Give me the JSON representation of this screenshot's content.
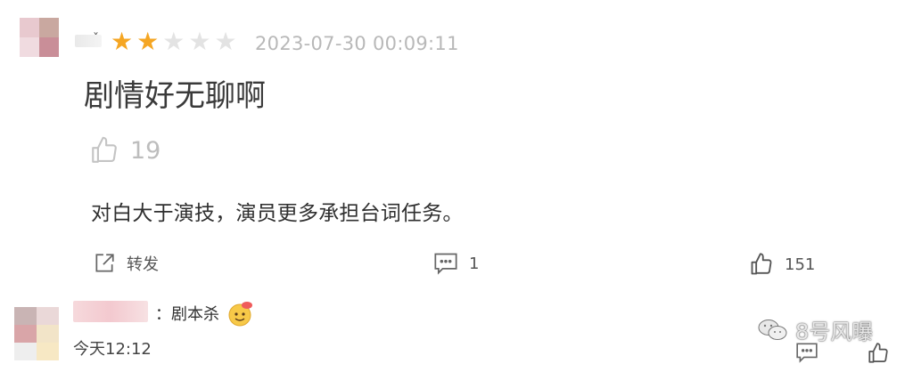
{
  "review": {
    "rating": 2,
    "rating_max": 5,
    "timestamp": "2023-07-30 00:09:11",
    "title": "剧情好无聊啊",
    "title_likes": "19",
    "body": "对白大于演技，演员更多承担台词任务。",
    "actions": {
      "share_label": "转发",
      "comment_count": "1",
      "like_count": "151"
    }
  },
  "reply": {
    "text": "：剧本杀",
    "time": "今天12:12"
  },
  "watermark": {
    "text": "8号风曝"
  },
  "colors": {
    "star_on": "#f5a623",
    "star_off": "#e3e3e3",
    "timestamp": "#b8b8b8"
  }
}
